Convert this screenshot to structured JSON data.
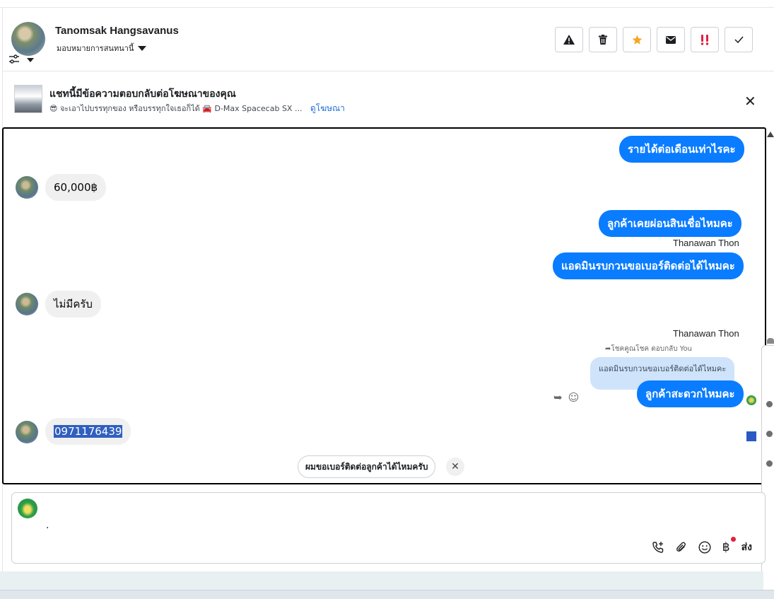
{
  "header": {
    "name": "Tanomsak Hangsavanus",
    "assign_label": "มอบหมายการสนทนานี้",
    "actions": [
      {
        "icon": "warning-icon",
        "glyph": "⚠"
      },
      {
        "icon": "trash-icon",
        "glyph": "🗑"
      },
      {
        "icon": "star-icon",
        "glyph": "★"
      },
      {
        "icon": "mail-icon",
        "glyph": "✉"
      },
      {
        "icon": "important-icon",
        "glyph": "‼"
      },
      {
        "icon": "check-icon",
        "glyph": "✓"
      }
    ]
  },
  "ad": {
    "title": "แชทนี้มีข้อความตอบกลับต่อโฆษณาของคุณ",
    "subtitle": "😎 จะเอาไปบรรทุกของ หรือบรรทุกใจเธอก็ได้ 🚘 D-Max Spacecab SX ...",
    "link": "ดูโฆษณา",
    "close": "✕"
  },
  "messages": {
    "m1": "รายได้ต่อเดือนเท่าไรคะ",
    "m2": "60,000฿",
    "m3": "ลูกค้าเคยผ่อนสินเชื่อไหมคะ",
    "sender1": "Thanawan Thon",
    "m4": "แอดมินรบกวนขอเบอร์ติดต่อได้ไหมคะ",
    "m5": "ไม่มีครับ",
    "sender2": "Thanawan Thon",
    "reply_meta": "โชคคูณโชค ตอบกลับ You",
    "quoted": "แอดมินรบกวนขอเบอร์ติดต่อได้ไหมคะ",
    "m6": "ลูกค้าสะดวกไหมคะ",
    "m7": "0971176439"
  },
  "suggestion": {
    "text": "ผมขอเบอร์ติดต่อลูกค้าได้ไหมครับ",
    "close": "✕"
  },
  "composer": {
    "text": ".",
    "send_label": "ส่ง"
  },
  "colors": {
    "outgoing": "#0a7cff",
    "incoming": "#f0f0f0",
    "link": "#216fdb"
  }
}
